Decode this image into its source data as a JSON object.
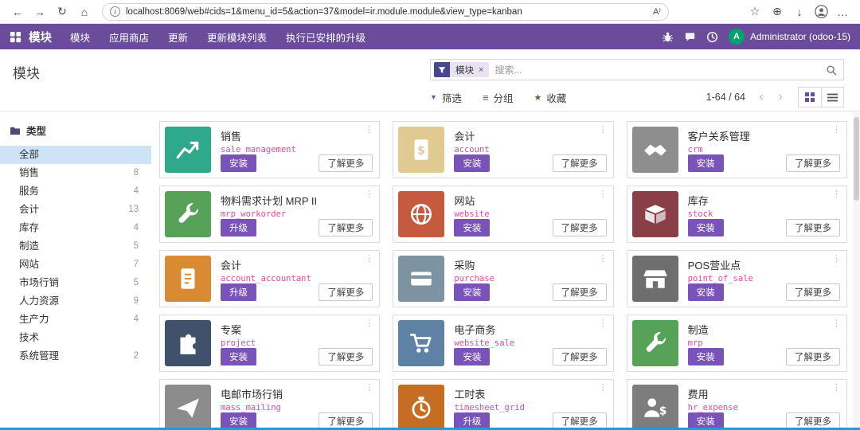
{
  "browser": {
    "url": "localhost:8069/web#cids=1&menu_id=5&action=37&model=ir.module.module&view_type=kanban"
  },
  "icons": {
    "back": "←",
    "forward": "→",
    "refresh": "↻",
    "home": "⌂",
    "info": "i",
    "read_aloud": "A⁾",
    "favorites": "☆",
    "collections": "⊕",
    "downloads": "↓",
    "more": "…",
    "kebab": "⋮",
    "prev": "‹",
    "next": "›",
    "filter": "▼",
    "group": "≡",
    "favorite_star": "★",
    "facet_remove": "×"
  },
  "navbar": {
    "title": "模块",
    "menu": [
      "模块",
      "应用商店",
      "更新",
      "更新模块列表",
      "执行已安排的升级"
    ],
    "user_initial": "A",
    "user_name": "Administrator (odoo-15)"
  },
  "header": {
    "page_title": "模块",
    "search_facet": "模块",
    "search_placeholder": "搜索...",
    "filters_label": "筛选",
    "groupby_label": "分组",
    "favorites_label": "收藏",
    "pager": "1-64 / 64"
  },
  "sidebar": {
    "title": "类型",
    "items": [
      {
        "label": "全部",
        "count": "",
        "active": true
      },
      {
        "label": "销售",
        "count": "8"
      },
      {
        "label": "服务",
        "count": "4"
      },
      {
        "label": "会计",
        "count": "13"
      },
      {
        "label": "库存",
        "count": "4"
      },
      {
        "label": "制造",
        "count": "5"
      },
      {
        "label": "网站",
        "count": "7"
      },
      {
        "label": "市场行销",
        "count": "5"
      },
      {
        "label": "人力资源",
        "count": "9"
      },
      {
        "label": "生产力",
        "count": "4"
      },
      {
        "label": "技术",
        "count": ""
      },
      {
        "label": "系统管理",
        "count": "2"
      }
    ]
  },
  "labels": {
    "learn_more": "了解更多"
  },
  "cards": [
    {
      "title": "销售",
      "tech": "sale_management",
      "action": "安装",
      "icon": "chart-line",
      "color": "#2fa98c"
    },
    {
      "title": "会计",
      "tech": "account",
      "action": "安装",
      "icon": "bill",
      "color": "#e0ca92"
    },
    {
      "title": "客户关系管理",
      "tech": "crm",
      "action": "安装",
      "icon": "handshake",
      "color": "#8e8e8e"
    },
    {
      "title": "物料需求计划 MRP II",
      "tech": "mrp_workorder",
      "action": "升级",
      "icon": "wrench",
      "color": "#56a259"
    },
    {
      "title": "网站",
      "tech": "website",
      "action": "安装",
      "icon": "globe",
      "color": "#c65a3e"
    },
    {
      "title": "库存",
      "tech": "stock",
      "action": "安装",
      "icon": "box",
      "color": "#8a3e46"
    },
    {
      "title": "会计",
      "tech": "account_accountant",
      "action": "升级",
      "icon": "document",
      "color": "#d98b33"
    },
    {
      "title": "采购",
      "tech": "purchase",
      "action": "安装",
      "icon": "card",
      "color": "#7e93a2"
    },
    {
      "title": "POS营业点",
      "tech": "point_of_sale",
      "action": "安装",
      "icon": "shop",
      "color": "#6e6e6e"
    },
    {
      "title": "专案",
      "tech": "project",
      "action": "安装",
      "icon": "puzzle",
      "color": "#40516b"
    },
    {
      "title": "电子商务",
      "tech": "website_sale",
      "action": "安装",
      "icon": "cart",
      "color": "#5e82a6"
    },
    {
      "title": "制造",
      "tech": "mrp",
      "action": "安装",
      "icon": "wrench",
      "color": "#56a259"
    },
    {
      "title": "电邮市场行销",
      "tech": "mass_mailing",
      "action": "安装",
      "icon": "paper-plane",
      "color": "#8c8c8c"
    },
    {
      "title": "工时表",
      "tech": "timesheet_grid",
      "action": "升级",
      "icon": "stopwatch",
      "color": "#c56d22"
    },
    {
      "title": "费用",
      "tech": "hr_expense",
      "action": "安装",
      "icon": "person-dollar",
      "color": "#7d7d7d"
    }
  ],
  "colors": {
    "navbar": "#6b4c9a",
    "button": "#7a53ba",
    "facet_icon_bg": "#47478f",
    "avatar": "#00a36c",
    "active_item_bg": "#cfe3f6",
    "tech_name": "#e24a9f"
  }
}
